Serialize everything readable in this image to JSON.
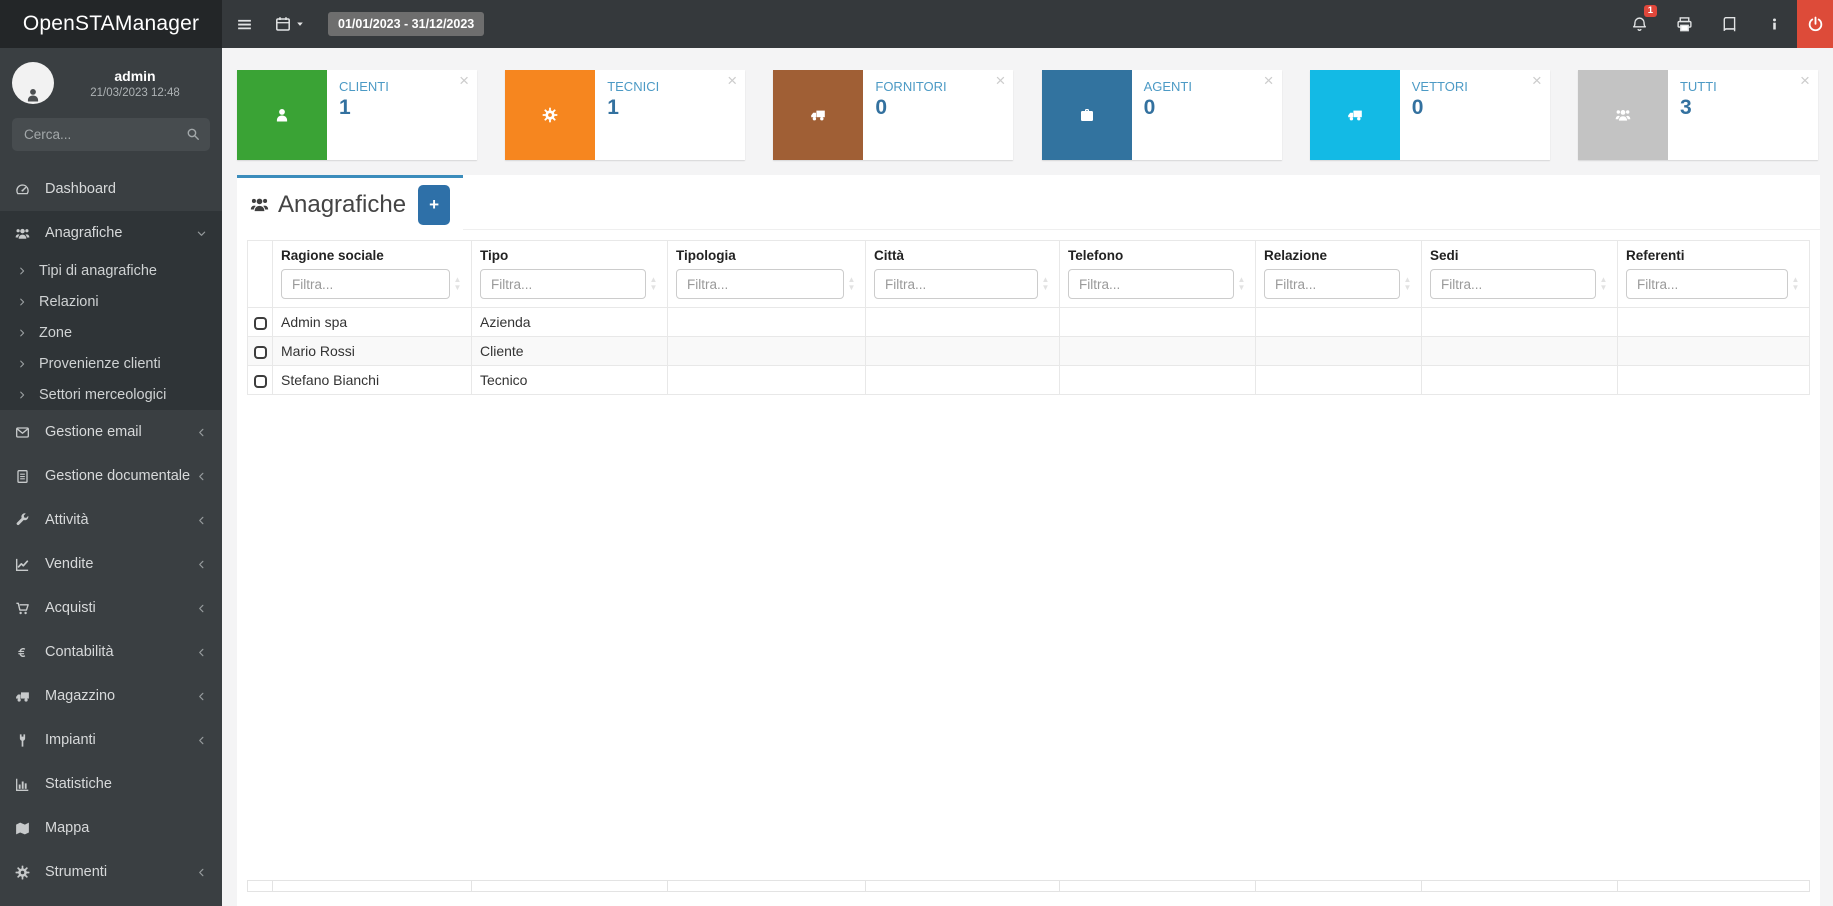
{
  "app": {
    "name": "OpenSTAManager"
  },
  "user": {
    "name": "admin",
    "last_login": "21/03/2023 12:48"
  },
  "search": {
    "placeholder": "Cerca..."
  },
  "topbar": {
    "date_range": "01/01/2023 - 31/12/2023",
    "notification_count": "1"
  },
  "sidebar": {
    "items": [
      {
        "icon": "tachometer-icon",
        "label": "Dashboard"
      },
      {
        "icon": "users-icon",
        "label": "Anagrafiche",
        "expanded": true,
        "children": [
          "Tipi di anagrafiche",
          "Relazioni",
          "Zone",
          "Provenienze clienti",
          "Settori merceologici"
        ]
      },
      {
        "icon": "envelope-icon",
        "label": "Gestione email",
        "collapsible": true
      },
      {
        "icon": "file-icon",
        "label": "Gestione documentale",
        "collapsible": true
      },
      {
        "icon": "wrench-icon",
        "label": "Attività",
        "collapsible": true
      },
      {
        "icon": "chart-line-icon",
        "label": "Vendite",
        "collapsible": true
      },
      {
        "icon": "cart-icon",
        "label": "Acquisti",
        "collapsible": true
      },
      {
        "icon": "euro-icon",
        "label": "Contabilità",
        "collapsible": true
      },
      {
        "icon": "truck-icon",
        "label": "Magazzino",
        "collapsible": true
      },
      {
        "icon": "plug-icon",
        "label": "Impianti",
        "collapsible": true
      },
      {
        "icon": "bar-chart-icon",
        "label": "Statistiche"
      },
      {
        "icon": "map-icon",
        "label": "Mappa"
      },
      {
        "icon": "gear-icon",
        "label": "Strumenti",
        "collapsible": true
      }
    ]
  },
  "stat_cards": [
    {
      "label": "CLIENTI",
      "value": "1",
      "color": "#3aa335",
      "icon": "person-icon"
    },
    {
      "label": "TECNICI",
      "value": "1",
      "color": "#f6861f",
      "icon": "gear-icon"
    },
    {
      "label": "FORNITORI",
      "value": "0",
      "color": "#a05f35",
      "icon": "truck-icon"
    },
    {
      "label": "AGENTI",
      "value": "0",
      "color": "#32739f",
      "icon": "briefcase-icon"
    },
    {
      "label": "VETTORI",
      "value": "0",
      "color": "#13bae5",
      "icon": "truck-icon"
    },
    {
      "label": "TUTTI",
      "value": "3",
      "color": "#c3c3c3",
      "icon": "users-icon"
    }
  ],
  "panel": {
    "title": "Anagrafiche",
    "icon": "users-icon",
    "add_button": "+"
  },
  "table": {
    "filter_placeholder": "Filtra...",
    "columns": [
      "Ragione sociale",
      "Tipo",
      "Tipologia",
      "Città",
      "Telefono",
      "Relazione",
      "Sedi",
      "Referenti"
    ],
    "rows": [
      [
        "Admin spa",
        "Azienda",
        "",
        "",
        "",
        "",
        "",
        ""
      ],
      [
        "Mario Rossi",
        "Cliente",
        "",
        "",
        "",
        "",
        "",
        ""
      ],
      [
        "Stefano Bianchi",
        "Tecnico",
        "",
        "",
        "",
        "",
        "",
        ""
      ]
    ]
  },
  "colors": {
    "accent": "#3c8dbc",
    "add_button_bg": "#2e70a8",
    "power_bg": "#dd4b39",
    "notification_badge_bg": "#e0473b",
    "date_badge_bg": "#6e6e6e"
  }
}
